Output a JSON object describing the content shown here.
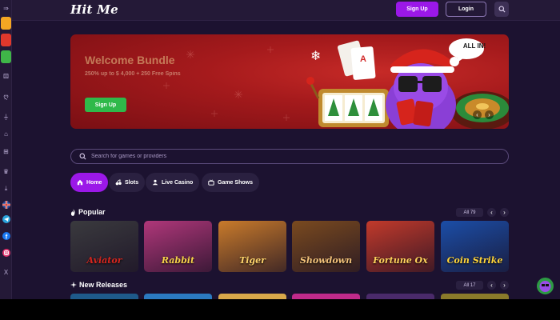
{
  "header": {
    "logo": "Hit Me",
    "signup_label": "Sign Up",
    "login_label": "Login",
    "search_icon": "search-icon"
  },
  "sidebar": {
    "items": [
      {
        "name": "collapse",
        "icon": "collapse-icon",
        "glyph": "⇒"
      },
      {
        "name": "promo-orange",
        "icon": "promo-thumb",
        "color": "#f5a623"
      },
      {
        "name": "promo-red",
        "icon": "promo-thumb",
        "color": "#e0382c"
      },
      {
        "name": "promo-green",
        "icon": "promo-thumb",
        "color": "#3fb648"
      },
      {
        "name": "casino",
        "icon": "dice-icon",
        "glyph": "⚄"
      },
      {
        "name": "slots",
        "icon": "cherry-icon",
        "glyph": "ღ"
      },
      {
        "name": "live",
        "icon": "dealer-icon",
        "glyph": "⏚"
      },
      {
        "name": "shows",
        "icon": "store-icon",
        "glyph": "⌂"
      },
      {
        "name": "promos",
        "icon": "gift-icon",
        "glyph": "⊞"
      },
      {
        "name": "tournaments",
        "icon": "trophy-icon",
        "glyph": "♛"
      },
      {
        "name": "download",
        "icon": "download-icon",
        "glyph": "⤓"
      },
      {
        "name": "language",
        "icon": "uk-flag-icon"
      },
      {
        "name": "telegram",
        "icon": "telegram-icon"
      },
      {
        "name": "facebook",
        "icon": "facebook-icon"
      },
      {
        "name": "instagram",
        "icon": "instagram-icon"
      },
      {
        "name": "x",
        "icon": "x-icon",
        "glyph": "X"
      }
    ]
  },
  "banner": {
    "title": "Welcome Bundle",
    "subtitle": "250% up to $ 4,000 + 250 Free Spins",
    "cta": "Sign Up",
    "bubble": "ALL IN!",
    "prev_glyph": "‹",
    "next_glyph": "›"
  },
  "search": {
    "placeholder": "Search for games or providers"
  },
  "tabs": [
    {
      "label": "Home",
      "icon": "home-icon",
      "active": true
    },
    {
      "label": "Slots",
      "icon": "cherry-icon",
      "active": false
    },
    {
      "label": "Live Casino",
      "icon": "dealer-icon",
      "active": false
    },
    {
      "label": "Game Shows",
      "icon": "tv-icon",
      "active": false
    }
  ],
  "popular": {
    "title": "Popular",
    "icon": "fire-icon",
    "all_label": "All 79",
    "prev_glyph": "‹",
    "next_glyph": "›",
    "games": [
      {
        "name": "Aviator",
        "bg": "#3a3a3e",
        "text_color": "#d8261f"
      },
      {
        "name": "Rabbit",
        "bg": "#b0377a",
        "text_color": "#f7d24a"
      },
      {
        "name": "Tiger",
        "bg": "#c97b2b",
        "text_color": "#ffd46b"
      },
      {
        "name": "Showdown",
        "bg": "#7a4a1f",
        "text_color": "#f3c27a"
      },
      {
        "name": "Fortune Ox",
        "bg": "#c23a2b",
        "text_color": "#ffd35c"
      },
      {
        "name": "Coin Strike",
        "bg": "#1b4ea8",
        "text_color": "#ffd53a"
      }
    ]
  },
  "new_releases": {
    "title": "New Releases",
    "icon": "sparkle-icon",
    "all_label": "All 17",
    "prev_glyph": "‹",
    "next_glyph": "›",
    "game_colors": [
      "#1e5a8a",
      "#2b7ac0",
      "#d9a84a",
      "#c02a8a",
      "#4a2a6a",
      "#8a7a2a"
    ]
  },
  "colors": {
    "accent": "#9b18e8",
    "cta_green": "#2fb94a",
    "bg": "#1c1230",
    "panel": "#241937"
  }
}
